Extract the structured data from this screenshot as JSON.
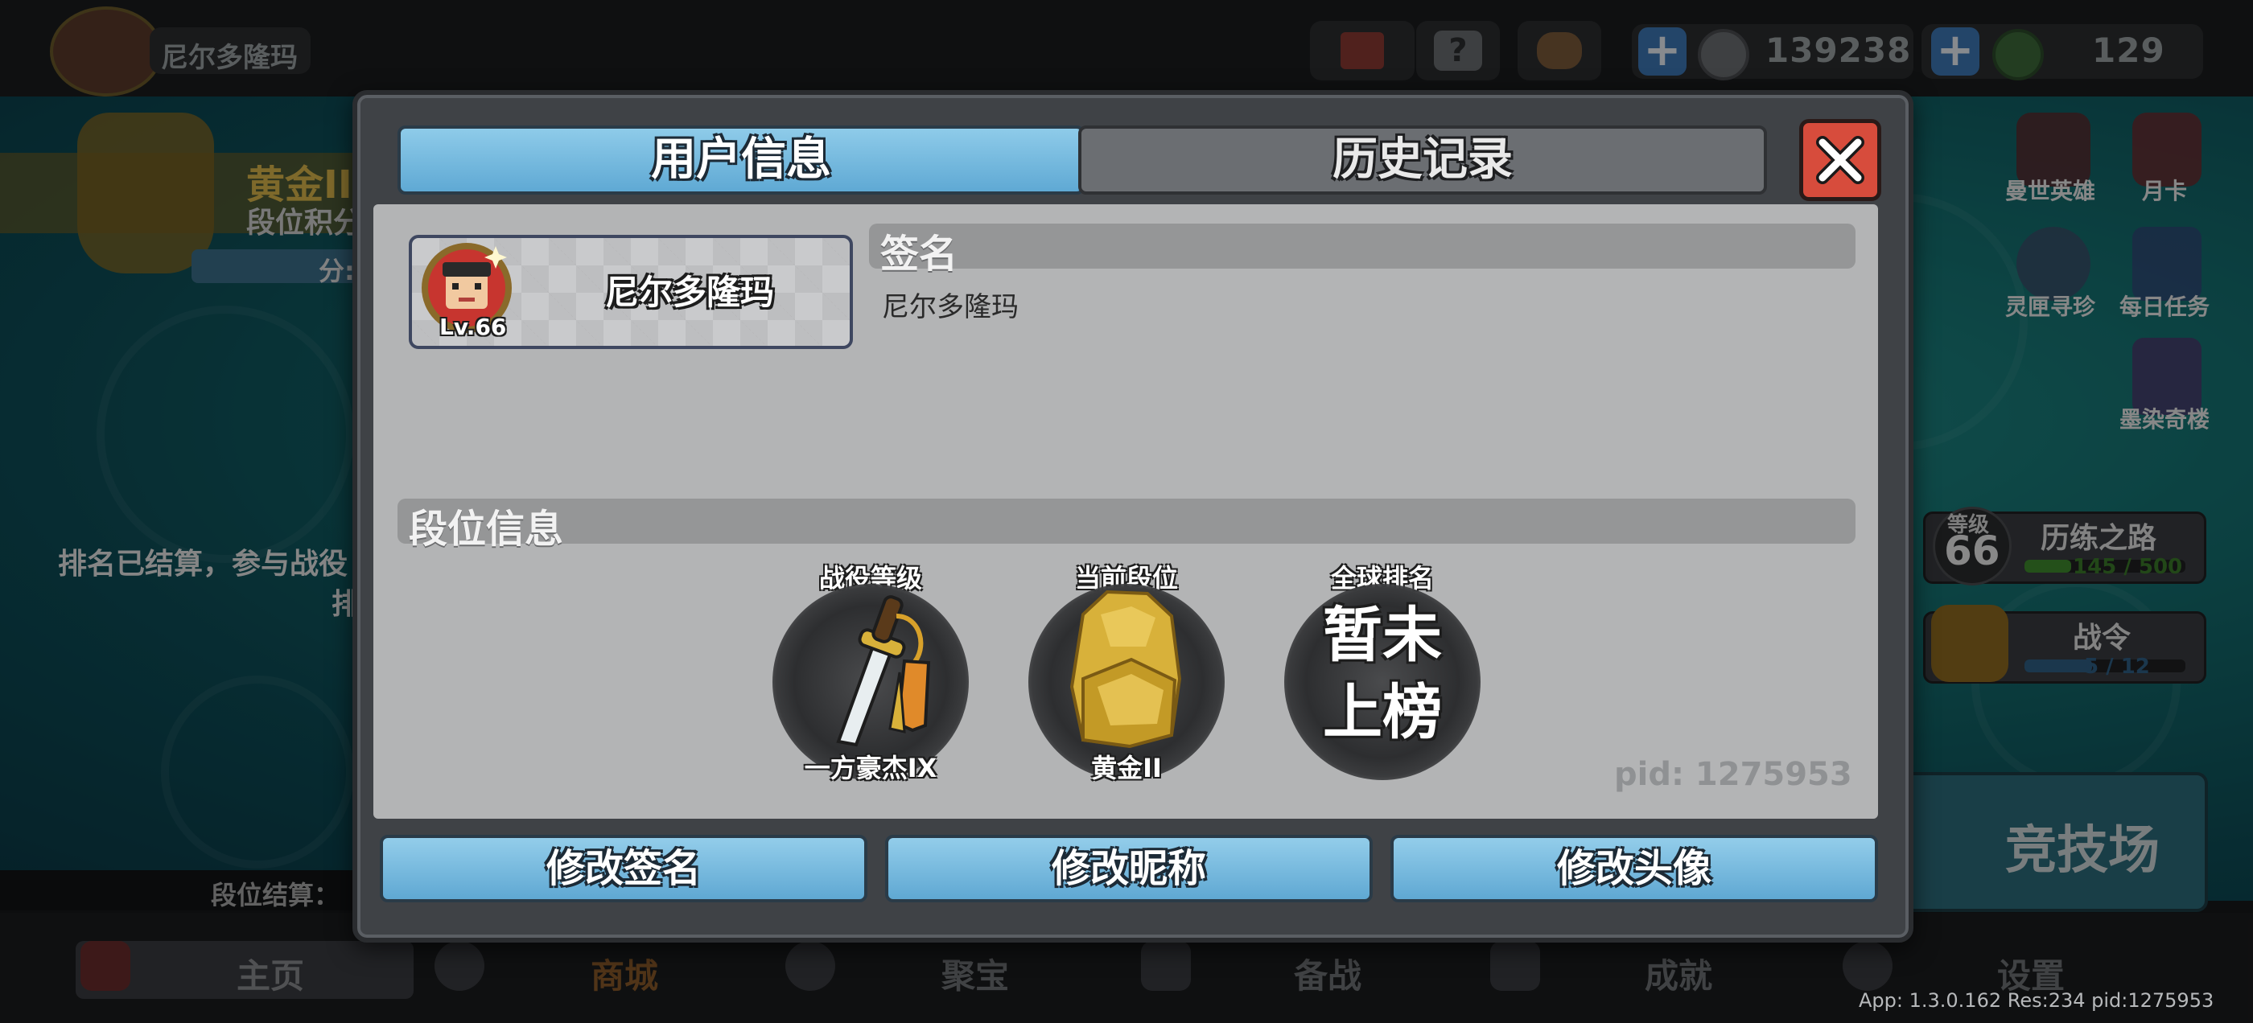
{
  "topbar": {
    "player_name": "尼尔多隆玛",
    "coins": "139238",
    "gems": "129"
  },
  "background": {
    "rank_title": "黄金II",
    "rank_score_label": "段位积分",
    "rank_score_partial": "分:",
    "settle_notice_line1": "排名已结算，参与战役",
    "settle_notice_line2": "排",
    "rank_settle_label": "段位结算：",
    "side_menu": [
      "曼世英雄",
      "月卡",
      "灵匣寻珍",
      "每日任务",
      "墨染奇楼"
    ],
    "level_label": "等级",
    "level_value": "66",
    "training_label": "历练之路",
    "training_progress": "145 / 500",
    "training_fraction": 0.29,
    "battlepass_label": "战令",
    "battlepass_progress": "5 / 12",
    "battlepass_fraction": 0.42,
    "arena_label": "竞技场"
  },
  "bottom_nav": [
    "主页",
    "商城",
    "聚宝",
    "备战",
    "成就",
    "设置"
  ],
  "footer_info": "App: 1.3.0.162 Res:234 pid:1275953",
  "modal": {
    "tabs": {
      "user_info": "用户信息",
      "history": "历史记录"
    },
    "profile": {
      "name": "尼尔多隆玛",
      "level": "Lv.66"
    },
    "signature": {
      "title": "签名",
      "text": "尼尔多隆玛"
    },
    "rank_info": {
      "title": "段位信息",
      "campaign_level_label": "战役等级",
      "campaign_level_value": "一方豪杰IX",
      "current_rank_label": "当前段位",
      "current_rank_value": "黄金II",
      "global_rank_label": "全球排名",
      "global_rank_line1": "暂未",
      "global_rank_line2": "上榜"
    },
    "pid": "pid: 1275953",
    "buttons": {
      "edit_signature": "修改签名",
      "edit_nickname": "修改昵称",
      "edit_avatar": "修改头像"
    }
  },
  "colors": {
    "tab_active": "#6fb5dc",
    "close_button": "#d74c3c",
    "content_bg": "#b3b4b5",
    "gold": "#d8b13a"
  }
}
